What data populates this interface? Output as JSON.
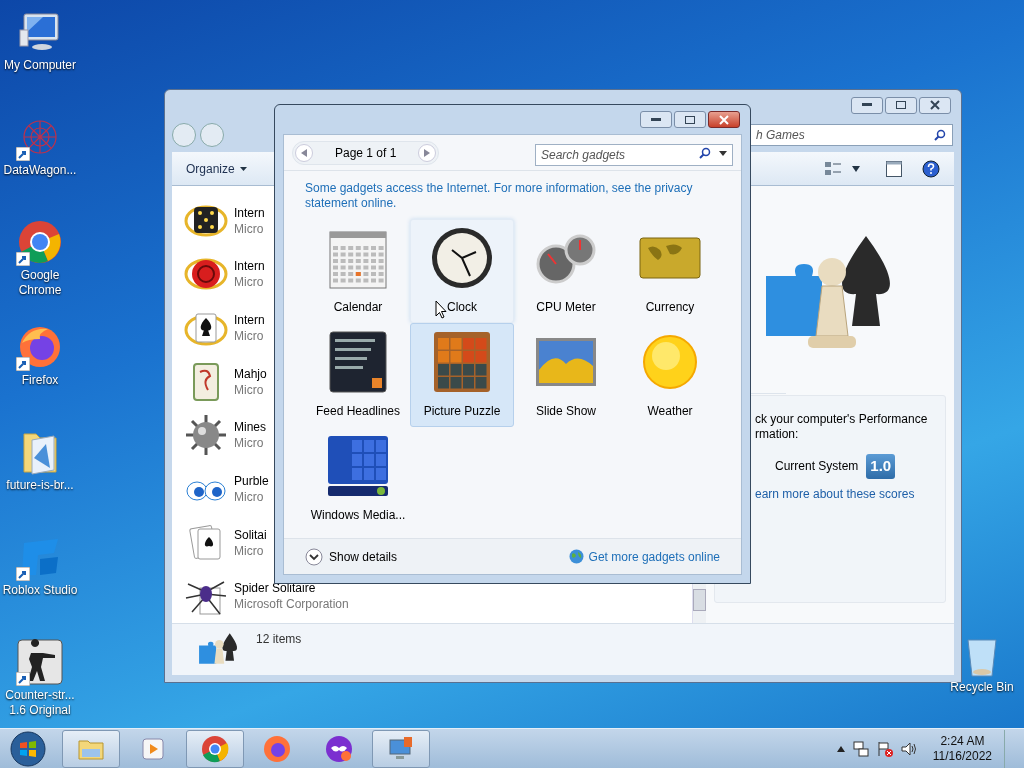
{
  "desktop_icons": [
    {
      "label": "My Computer",
      "kind": "computer",
      "shortcut": false
    },
    {
      "label": "DataWagon...",
      "kind": "web",
      "shortcut": true
    },
    {
      "label": "Google Chrome",
      "kind": "chrome",
      "shortcut": true
    },
    {
      "label": "Firefox",
      "kind": "firefox",
      "shortcut": true
    },
    {
      "label": "future-is-br...",
      "kind": "folder",
      "shortcut": false
    },
    {
      "label": "Roblox Studio",
      "kind": "roblox",
      "shortcut": true
    },
    {
      "label": "Counter-str... 1.6 Original",
      "kind": "game",
      "shortcut": true
    }
  ],
  "recycle_bin": {
    "label": "Recycle Bin"
  },
  "explorer": {
    "search": {
      "value": "h Games"
    },
    "toolbar": {
      "organize": "Organize"
    },
    "items": [
      {
        "name": "Intern",
        "publisher": "Micro",
        "kind": "dice"
      },
      {
        "name": "Intern",
        "publisher": "Micro",
        "kind": "checkers"
      },
      {
        "name": "Intern",
        "publisher": "Micro",
        "kind": "spades"
      },
      {
        "name": "Mahjo",
        "publisher": "Micro",
        "kind": "mahjong"
      },
      {
        "name": "Mines",
        "publisher": "Micro",
        "kind": "mine"
      },
      {
        "name": "Purble",
        "publisher": "Micro",
        "kind": "eyes"
      },
      {
        "name": "Solitai",
        "publisher": "Micro",
        "kind": "cards"
      },
      {
        "name": "Spider Solitaire",
        "publisher": "Microsoft Corporation",
        "kind": "spider"
      }
    ],
    "details": {
      "text_line_1": "ck your computer's Performance",
      "text_line_2": "rmation:",
      "score_label": "Current System",
      "score": "1.0",
      "link": "earn more about these scores"
    },
    "status_bar": {
      "count": "12 items"
    }
  },
  "gadget_window": {
    "page": "Page 1 of 1",
    "search": {
      "placeholder": "Search gadgets"
    },
    "notice": "Some gadgets access the Internet.  For more information, see the privacy statement online.",
    "gadgets": [
      {
        "label": "Calendar",
        "kind": "calendar",
        "selected": false,
        "hovered": false
      },
      {
        "label": "Clock",
        "kind": "clock",
        "selected": false,
        "hovered": true
      },
      {
        "label": "CPU Meter",
        "kind": "cpu",
        "selected": false,
        "hovered": false
      },
      {
        "label": "Currency",
        "kind": "currency",
        "selected": false,
        "hovered": false
      },
      {
        "label": "Feed Headlines",
        "kind": "feed",
        "selected": false,
        "hovered": false
      },
      {
        "label": "Picture Puzzle",
        "kind": "puzzle",
        "selected": true,
        "hovered": false
      },
      {
        "label": "Slide Show",
        "kind": "slideshow",
        "selected": false,
        "hovered": false
      },
      {
        "label": "Weather",
        "kind": "weather",
        "selected": false,
        "hovered": false
      },
      {
        "label": "Windows Media...",
        "kind": "media",
        "selected": false,
        "hovered": false
      }
    ],
    "show_details": "Show details",
    "more_link": "Get more gadgets online"
  },
  "taskbar": {
    "apps": [
      {
        "kind": "explorer",
        "active": true
      },
      {
        "kind": "player",
        "active": false
      },
      {
        "kind": "chrome",
        "active": true
      },
      {
        "kind": "firefox",
        "active": false
      },
      {
        "kind": "mask",
        "active": false
      },
      {
        "kind": "remote",
        "active": true
      }
    ],
    "time": "2:24 AM",
    "date": "11/16/2022"
  }
}
